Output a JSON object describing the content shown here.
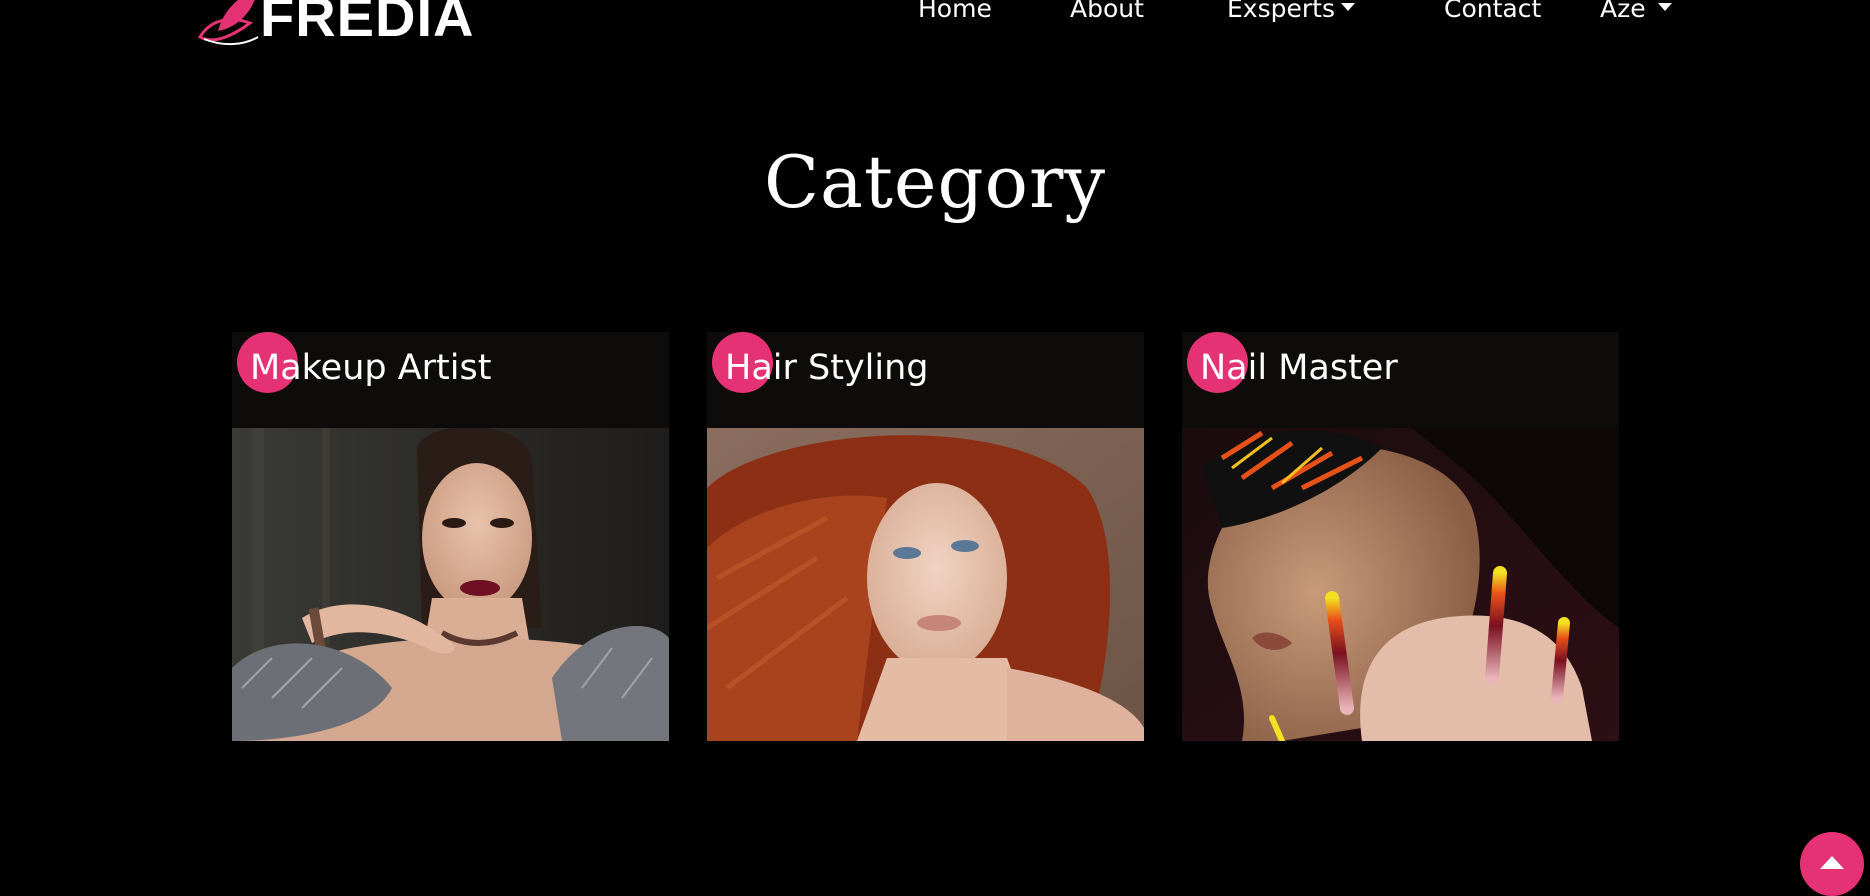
{
  "brand": {
    "name": "FREDIA",
    "accent_color": "#e53274",
    "icon": "butterfly-leaf-logo"
  },
  "nav": {
    "home": "Home",
    "about": "About",
    "experts": "Exsperts",
    "contact": "Contact",
    "language": "Aze"
  },
  "section": {
    "title": "Category"
  },
  "categories": [
    {
      "title": "Makeup Artist",
      "image": "makeup-portrait"
    },
    {
      "title": "Hair Styling",
      "image": "red-hair-portrait"
    },
    {
      "title": "Nail Master",
      "image": "nail-art-portrait"
    }
  ],
  "scroll_top": {
    "icon": "arrow-up-icon"
  }
}
